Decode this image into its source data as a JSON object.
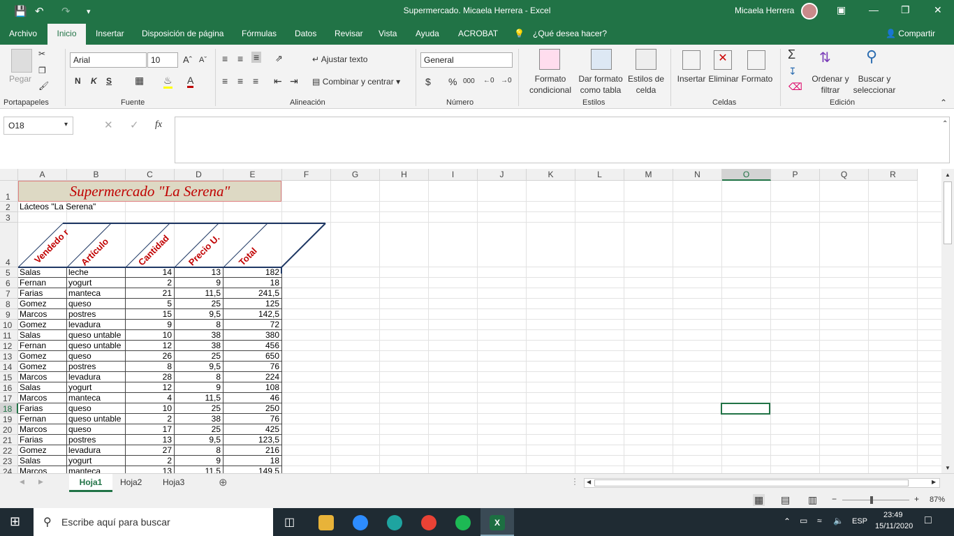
{
  "titlebar": {
    "title": "Supermercado. Micaela Herrera  -  Excel",
    "user": "Micaela Herrera"
  },
  "tabs": [
    "Archivo",
    "Inicio",
    "Insertar",
    "Disposición de página",
    "Fórmulas",
    "Datos",
    "Revisar",
    "Vista",
    "Ayuda",
    "ACROBAT",
    "¿Qué desea hacer?"
  ],
  "share": "Compartir",
  "ribbon": {
    "paste": "Pegar",
    "font_name": "Arial",
    "font_size": "10",
    "bold": "N",
    "italic": "K",
    "underline": "S",
    "wrap": "Ajustar texto",
    "merge": "Combinar y centrar",
    "numfmt": "General",
    "percent": "%",
    "thousands": "000",
    "cond_fmt": "Formato condicional",
    "as_table": "Dar formato como tabla",
    "cell_styles": "Estilos de celda",
    "insert": "Insertar",
    "delete": "Eliminar",
    "format": "Formato",
    "sort": "Ordenar y filtrar",
    "find": "Buscar y seleccionar",
    "groups": [
      "Portapapeles",
      "Fuente",
      "Alineación",
      "Número",
      "Estilos",
      "Celdas",
      "Edición"
    ]
  },
  "namebox": "O18",
  "fx": "fx",
  "columns": [
    "A",
    "B",
    "C",
    "D",
    "E",
    "F",
    "G",
    "H",
    "I",
    "J",
    "K",
    "L",
    "M",
    "N",
    "O",
    "P",
    "Q",
    "R"
  ],
  "sheet_title": "Supermercado \"La Serena\"",
  "subtitle": "Lácteos \"La Serena\"",
  "headers": [
    "Vendedo r",
    "Artículo",
    "Cantidad",
    "Precio U.",
    "Total"
  ],
  "rows": [
    [
      "Salas",
      "leche",
      "14",
      "13",
      "182"
    ],
    [
      "Fernan",
      "yogurt",
      "2",
      "9",
      "18"
    ],
    [
      "Farias",
      "manteca",
      "21",
      "11,5",
      "241,5"
    ],
    [
      "Gomez",
      "queso",
      "5",
      "25",
      "125"
    ],
    [
      "Marcos",
      "postres",
      "15",
      "9,5",
      "142,5"
    ],
    [
      "Gomez",
      "levadura",
      "9",
      "8",
      "72"
    ],
    [
      "Salas",
      "queso untable",
      "10",
      "38",
      "380"
    ],
    [
      "Fernan",
      "queso untable",
      "12",
      "38",
      "456"
    ],
    [
      "Gomez",
      "queso",
      "26",
      "25",
      "650"
    ],
    [
      "Gomez",
      "postres",
      "8",
      "9,5",
      "76"
    ],
    [
      "Marcos",
      "levadura",
      "28",
      "8",
      "224"
    ],
    [
      "Salas",
      "yogurt",
      "12",
      "9",
      "108"
    ],
    [
      "Marcos",
      "manteca",
      "4",
      "11,5",
      "46"
    ],
    [
      "Farias",
      "queso",
      "10",
      "25",
      "250"
    ],
    [
      "Fernan",
      "queso untable",
      "2",
      "38",
      "76"
    ],
    [
      "Marcos",
      "queso",
      "17",
      "25",
      "425"
    ],
    [
      "Farias",
      "postres",
      "13",
      "9,5",
      "123,5"
    ],
    [
      "Gomez",
      "levadura",
      "27",
      "8",
      "216"
    ],
    [
      "Salas",
      "yogurt",
      "2",
      "9",
      "18"
    ],
    [
      "Marcos",
      "manteca",
      "13",
      "11,5",
      "149,5"
    ]
  ],
  "sheets": [
    "Hoja1",
    "Hoja2",
    "Hoja3"
  ],
  "zoom": "87%",
  "taskbar": {
    "search": "Escribe aquí para buscar",
    "lang": "ESP",
    "time": "23:49",
    "date": "15/11/2020"
  },
  "colors": {
    "excel_green": "#217346",
    "header_red": "#c00000",
    "title_bg": "#ddd9c4"
  }
}
